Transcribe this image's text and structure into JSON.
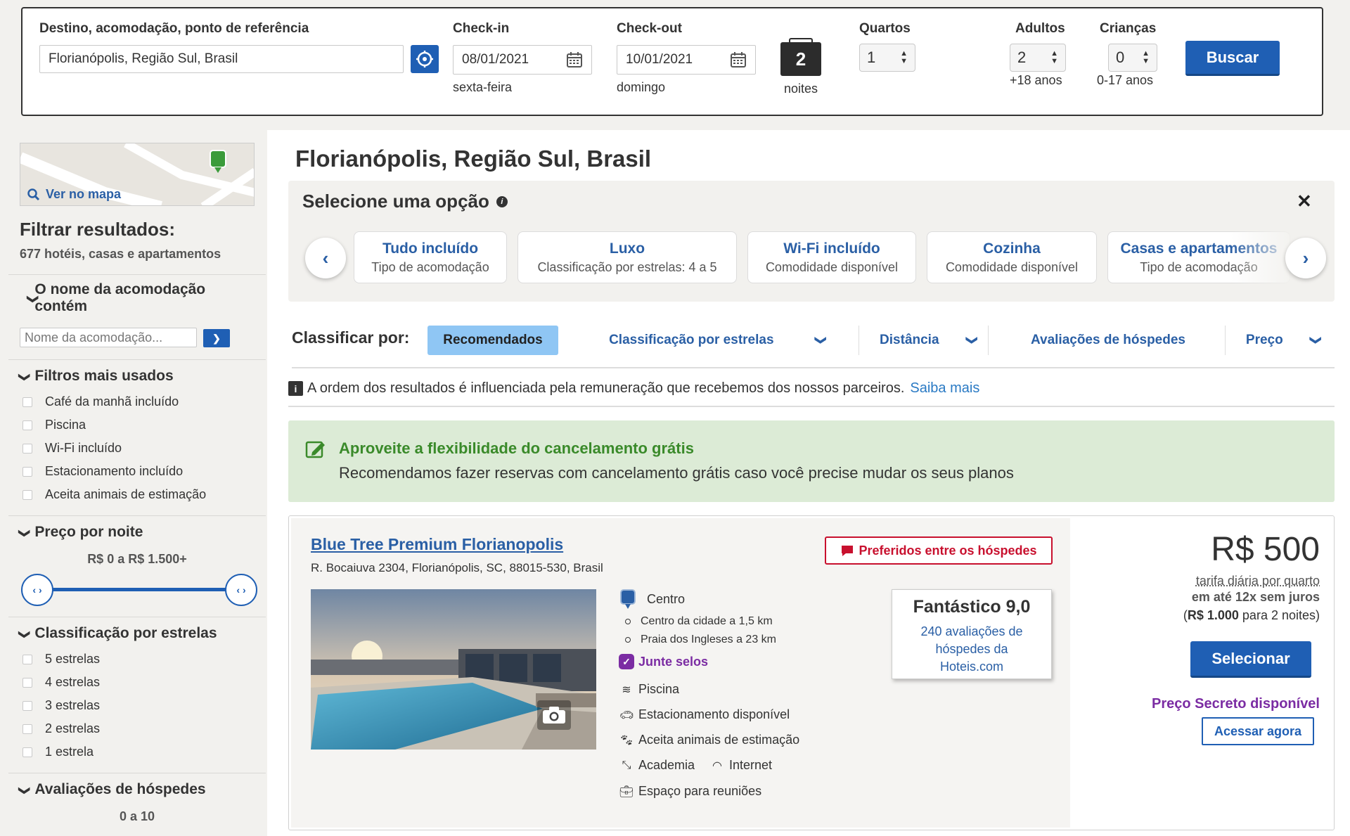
{
  "search": {
    "destination_label": "Destino, acomodação, ponto de referência",
    "destination_value": "Florianópolis, Região Sul, Brasil",
    "checkin_label": "Check-in",
    "checkin_value": "08/01/2021",
    "checkin_day": "sexta-feira",
    "checkout_label": "Check-out",
    "checkout_value": "10/01/2021",
    "checkout_day": "domingo",
    "nights_count": "2",
    "nights_label": "noites",
    "rooms_label": "Quartos",
    "rooms_value": "1",
    "adults_label": "Adultos",
    "adults_value": "2",
    "adults_sub": "+18 anos",
    "children_label": "Crianças",
    "children_value": "0",
    "children_sub": "0-17 anos",
    "search_button": "Buscar"
  },
  "sidebar": {
    "map_link": "Ver no mapa",
    "filter_title": "Filtrar resultados:",
    "results_count": "677 hotéis, casas e apartamentos",
    "name_section": "O nome da acomodação contém",
    "name_placeholder": "Nome da acomodação...",
    "popular_title": "Filtros mais usados",
    "popular": [
      "Café da manhã incluído",
      "Piscina",
      "Wi-Fi incluído",
      "Estacionamento incluído",
      "Aceita animais de estimação"
    ],
    "price_title": "Preço por noite",
    "price_range": "R$ 0 a R$ 1.500+",
    "stars_title": "Classificação por estrelas",
    "stars": [
      "5 estrelas",
      "4 estrelas",
      "3 estrelas",
      "2 estrelas",
      "1 estrela"
    ],
    "reviews_title": "Avaliações de hóspedes",
    "reviews_range": "0 a 10"
  },
  "main": {
    "page_title": "Florianópolis, Região Sul, Brasil",
    "options_title": "Selecione uma opção",
    "chips": [
      {
        "title": "Tudo incluído",
        "sub": "Tipo de acomodação"
      },
      {
        "title": "Luxo",
        "sub": "Classificação por estrelas: 4 a 5"
      },
      {
        "title": "Wi-Fi incluído",
        "sub": "Comodidade disponível"
      },
      {
        "title": "Cozinha",
        "sub": "Comodidade disponível"
      },
      {
        "title": "Casas e apartamentos",
        "sub": "Tipo de acomodação"
      }
    ],
    "sort_label": "Classificar por:",
    "sort_options": [
      "Recomendados",
      "Classificação por estrelas",
      "Distância",
      "Avaliações de hóspedes",
      "Preço"
    ],
    "disclaimer": "A ordem dos resultados é influenciada pela remuneração que recebemos dos nossos parceiros.",
    "disclaimer_link": "Saiba mais",
    "banner_title": "Aproveite a flexibilidade do cancelamento grátis",
    "banner_text": "Recomendamos fazer reservas com cancelamento grátis caso você precise mudar os seus planos"
  },
  "hotel": {
    "name": "Blue Tree Premium Florianopolis",
    "address": "R. Bocaiuva 2304, Florianópolis, SC, 88015-530, Brasil",
    "badge": "Preferidos entre os hóspedes",
    "area": "Centro",
    "distances": [
      "Centro da cidade a 1,5 km",
      "Praia dos Ingleses a 23 km"
    ],
    "loyalty": "Junte selos",
    "amenities": [
      "Piscina",
      "Estacionamento disponível",
      "Aceita animais de estimação",
      "Academia",
      "Internet",
      "Espaço para reuniões"
    ],
    "rating_label": "Fantástico 9,0",
    "rating_reviews": "240 avaliações de hóspedes da Hoteis.com",
    "price": "R$ 500",
    "price_note": "tarifa diária por quarto",
    "installments": "em até 12x sem juros",
    "total_prefix": "(",
    "total": "R$ 1.000",
    "total_suffix": " para 2 noites)",
    "select_button": "Selecionar",
    "secret_price": "Preço Secreto disponível",
    "access_button": "Acessar agora"
  },
  "colors": {
    "primary": "#1f5fb4",
    "link": "#2a5fa5",
    "green_banner": "#dcebd6",
    "badge_red": "#c8102e",
    "purple": "#7b2ca3"
  }
}
